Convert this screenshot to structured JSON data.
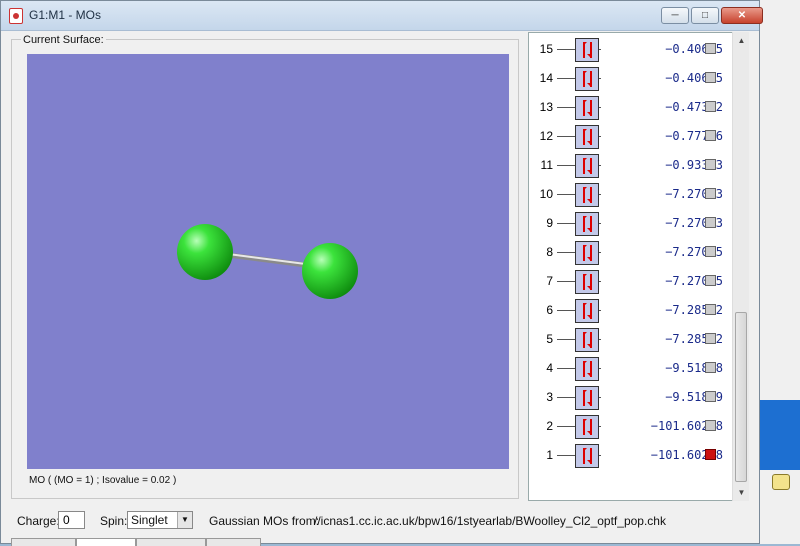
{
  "window": {
    "title": "G1:M1 - MOs"
  },
  "surface": {
    "label": "Current Surface:",
    "caption": "MO ( (MO = 1) ; Isovalue = 0.02 )"
  },
  "mo_list": [
    {
      "num": "15",
      "energy": "−0.40695",
      "selected": false
    },
    {
      "num": "14",
      "energy": "−0.40695",
      "selected": false
    },
    {
      "num": "13",
      "energy": "−0.47392",
      "selected": false
    },
    {
      "num": "12",
      "energy": "−0.77746",
      "selected": false
    },
    {
      "num": "11",
      "energy": "−0.93313",
      "selected": false
    },
    {
      "num": "10",
      "energy": "−7.27043",
      "selected": false
    },
    {
      "num": "9",
      "energy": "−7.27043",
      "selected": false
    },
    {
      "num": "8",
      "energy": "−7.27045",
      "selected": false
    },
    {
      "num": "7",
      "energy": "−7.27045",
      "selected": false
    },
    {
      "num": "6",
      "energy": "−7.28592",
      "selected": false
    },
    {
      "num": "5",
      "energy": "−7.28592",
      "selected": false
    },
    {
      "num": "4",
      "energy": "−9.51828",
      "selected": false
    },
    {
      "num": "3",
      "energy": "−9.51829",
      "selected": false
    },
    {
      "num": "2",
      "energy": "−101.60298",
      "selected": false
    },
    {
      "num": "1",
      "energy": "−101.60298",
      "selected": true
    }
  ],
  "controls": {
    "charge_label": "Charge:",
    "charge_value": "0",
    "spin_label": "Spin:",
    "spin_value": "Singlet",
    "source_label": "Gaussian MOs from:",
    "source_path": "//icnas1.cc.ic.ac.uk/bpw16/1styearlab/BWoolley_Cl2_optf_pop.chk"
  },
  "colors": {
    "viewer_bg": "#8080cc",
    "atom": "#33dd33",
    "selected_check": "#cc1111",
    "energy_text": "#1a2a8a"
  }
}
